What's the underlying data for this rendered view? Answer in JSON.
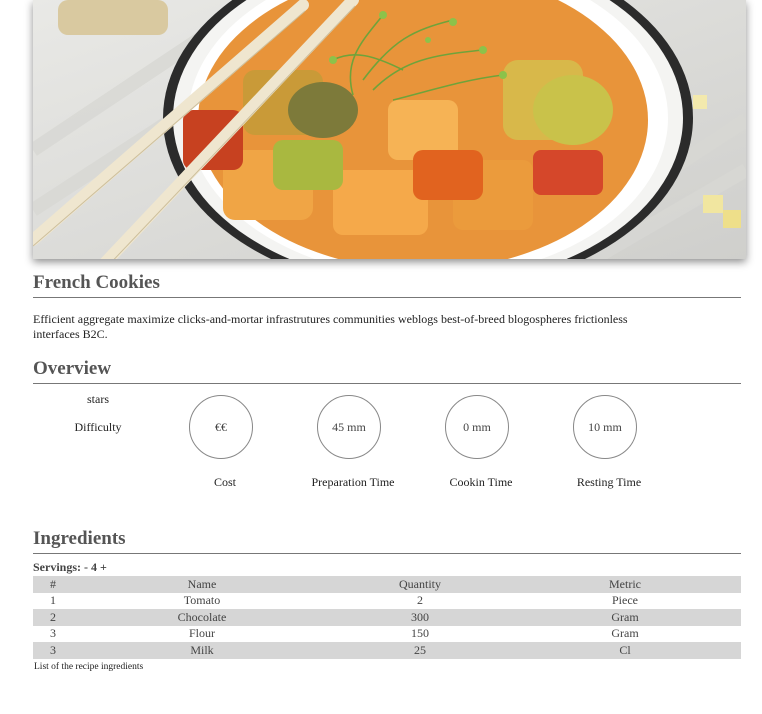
{
  "hero": {
    "image": "vegetable-bowl-photo"
  },
  "recipe": {
    "title": "French Cookies",
    "description": "Efficient aggregate maximize clicks-and-mortar infrastrutures communities weblogs best-of-breed blogospheres frictionless interfaces B2C."
  },
  "overview": {
    "heading": "Overview",
    "stars_label": "stars",
    "difficulty_label": "Difficulty",
    "items": [
      {
        "value": "€€",
        "label": "Cost"
      },
      {
        "value": "45 mm",
        "label": "Preparation Time"
      },
      {
        "value": "0 mm",
        "label": "Cookin Time"
      },
      {
        "value": "10 mm",
        "label": "Resting Time"
      }
    ]
  },
  "ingredients": {
    "heading": "Ingredients",
    "servings_label": "Servings:",
    "minus": "-",
    "count": "4",
    "plus": "+",
    "columns": [
      "#",
      "Name",
      "Quantity",
      "Metric"
    ],
    "rows": [
      [
        "1",
        "Tomato",
        "2",
        "Piece"
      ],
      [
        "2",
        "Chocolate",
        "300",
        "Gram"
      ],
      [
        "3",
        "Flour",
        "150",
        "Gram"
      ],
      [
        "3",
        "Milk",
        "25",
        "Cl"
      ]
    ],
    "caption": "List of the recipe ingredients"
  }
}
